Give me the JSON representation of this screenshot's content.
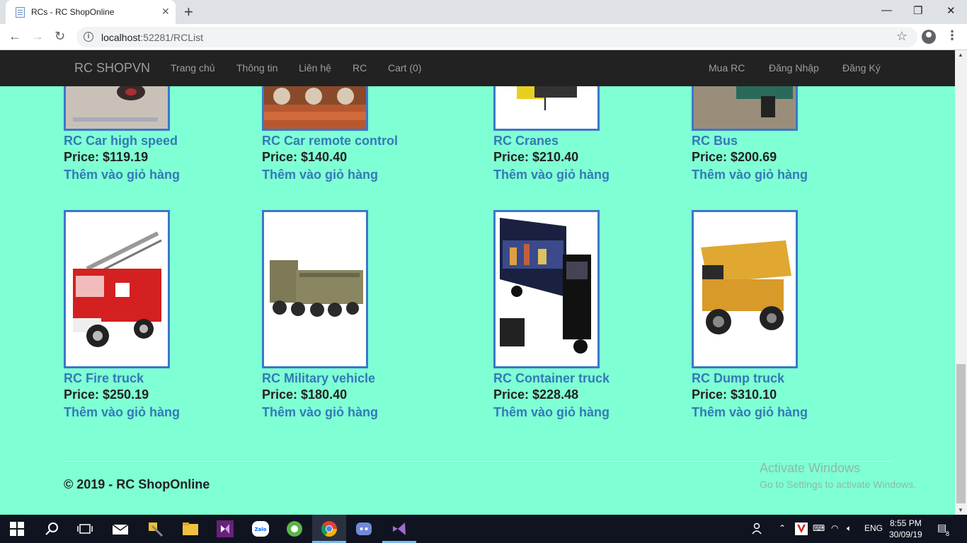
{
  "browser": {
    "tab_title": "RCs - RC ShopOnline",
    "url_host": "localhost",
    "url_rest": ":52281/RCList"
  },
  "navbar": {
    "brand": "RC SHOPVN",
    "left_links": [
      "Trang chủ",
      "Thông tin",
      "Liên hệ",
      "RC",
      "Cart (0)"
    ],
    "right_links": [
      "Mua RC",
      "Đăng Nhập",
      "Đăng Ký"
    ]
  },
  "products_top": [
    {
      "name": "RC Car high speed",
      "price": "Price: $119.19",
      "add": "Thêm vào giỏ hàng"
    },
    {
      "name": "RC Car remote control",
      "price": "Price: $140.40",
      "add": "Thêm vào giỏ hàng"
    },
    {
      "name": "RC Cranes",
      "price": "Price: $210.40",
      "add": "Thêm vào giỏ hàng"
    },
    {
      "name": "RC Bus",
      "price": "Price: $200.69",
      "add": "Thêm vào giỏ hàng"
    }
  ],
  "products_bottom": [
    {
      "name": "RC Fire truck",
      "price": "Price: $250.19",
      "add": "Thêm vào giỏ hàng"
    },
    {
      "name": "RC Military vehicle",
      "price": "Price: $180.40",
      "add": "Thêm vào giỏ hàng"
    },
    {
      "name": "RC Container truck",
      "price": "Price: $228.48",
      "add": "Thêm vào giỏ hàng"
    },
    {
      "name": "RC Dump truck",
      "price": "Price: $310.10",
      "add": "Thêm vào giỏ hàng"
    }
  ],
  "footer": "© 2019 - RC ShopOnline",
  "watermark": {
    "title": "Activate Windows",
    "subtitle": "Go to Settings to activate Windows."
  },
  "taskbar": {
    "lang": "ENG",
    "time": "8:55 PM",
    "date": "30/09/19",
    "notifications": "8"
  }
}
